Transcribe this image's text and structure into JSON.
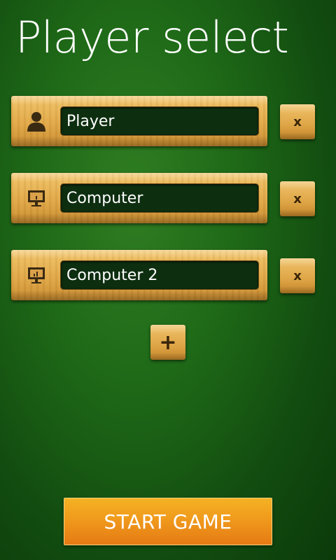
{
  "page": {
    "title": "Player select"
  },
  "players": [
    {
      "type_icon": "person-icon",
      "name": "Player",
      "remove_label": "x"
    },
    {
      "type_icon": "computer-icon",
      "name": "Computer",
      "remove_label": "x"
    },
    {
      "type_icon": "computer-icon",
      "name": "Computer 2",
      "remove_label": "x"
    }
  ],
  "actions": {
    "add_player_label": "+",
    "start_game_label": "START GAME"
  },
  "colors": {
    "background": "#1f6a18",
    "wood": "#e0a848",
    "name_field": "#0e2e10",
    "start_button": "#f09a1c"
  }
}
